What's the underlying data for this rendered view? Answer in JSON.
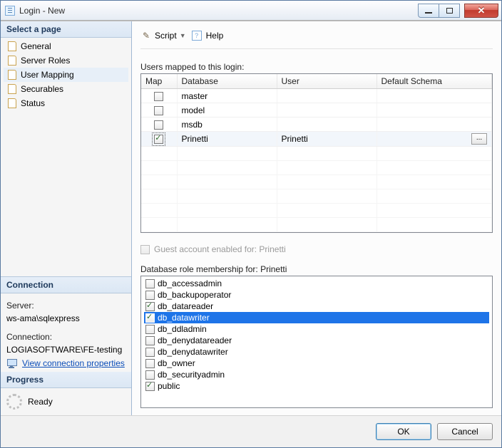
{
  "window": {
    "title": "Login - New"
  },
  "toolbar": {
    "script": "Script",
    "help": "Help"
  },
  "left": {
    "select_page": "Select a page",
    "items": [
      {
        "label": "General"
      },
      {
        "label": "Server Roles"
      },
      {
        "label": "User Mapping",
        "selected": true
      },
      {
        "label": "Securables"
      },
      {
        "label": "Status"
      }
    ],
    "connection": {
      "header": "Connection",
      "server_label": "Server:",
      "server_value": "ws-ama\\sqlexpress",
      "conn_label": "Connection:",
      "conn_value": "LOGIASOFTWARE\\FE-testing",
      "view_props": "View connection properties"
    },
    "progress": {
      "header": "Progress",
      "state": "Ready"
    }
  },
  "main": {
    "users_mapped_label": "Users mapped to this login:",
    "columns": {
      "map": "Map",
      "database": "Database",
      "user": "User",
      "schema": "Default Schema"
    },
    "rows": [
      {
        "checked": false,
        "database": "master",
        "user": "",
        "schema": ""
      },
      {
        "checked": false,
        "database": "model",
        "user": "",
        "schema": ""
      },
      {
        "checked": false,
        "database": "msdb",
        "user": "",
        "schema": ""
      },
      {
        "checked": true,
        "database": "Prinetti",
        "user": "Prinetti",
        "schema": "",
        "selected": true
      }
    ],
    "guest_label": "Guest account enabled for: Prinetti",
    "roles_label": "Database role membership for: Prinetti",
    "roles": [
      {
        "name": "db_accessadmin",
        "checked": false
      },
      {
        "name": "db_backupoperator",
        "checked": false
      },
      {
        "name": "db_datareader",
        "checked": true
      },
      {
        "name": "db_datawriter",
        "checked": true,
        "selected": true
      },
      {
        "name": "db_ddladmin",
        "checked": false
      },
      {
        "name": "db_denydatareader",
        "checked": false
      },
      {
        "name": "db_denydatawriter",
        "checked": false
      },
      {
        "name": "db_owner",
        "checked": false
      },
      {
        "name": "db_securityadmin",
        "checked": false
      },
      {
        "name": "public",
        "checked": true
      }
    ]
  },
  "buttons": {
    "ok": "OK",
    "cancel": "Cancel"
  }
}
